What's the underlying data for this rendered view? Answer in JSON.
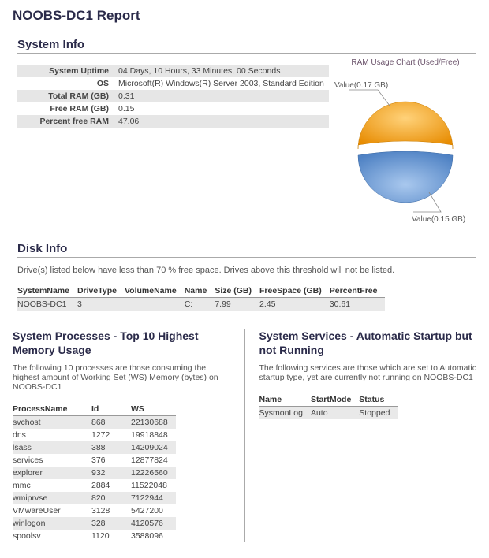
{
  "title": "NOOBS-DC1 Report",
  "system_info": {
    "heading": "System Info",
    "rows": [
      {
        "k": "System Uptime",
        "v": "04 Days, 10 Hours, 33 Minutes, 00 Seconds"
      },
      {
        "k": "OS",
        "v": "Microsoft(R) Windows(R) Server 2003, Standard Edition"
      },
      {
        "k": "Total RAM (GB)",
        "v": "0.31"
      },
      {
        "k": "Free RAM (GB)",
        "v": "0.15"
      },
      {
        "k": "Percent free RAM",
        "v": "47.06"
      }
    ]
  },
  "chart": {
    "title": "RAM Usage Chart (Used/Free)",
    "label_used": "Value(0.17 GB)",
    "label_free": "Value(0.15 GB)",
    "colors": {
      "used": "#f5a623",
      "used_dark": "#c97c00",
      "free": "#6aa0de",
      "free_dark": "#3d6aa3"
    }
  },
  "chart_data": {
    "type": "pie",
    "title": "RAM Usage Chart (Used/Free)",
    "categories": [
      "Used",
      "Free"
    ],
    "values": [
      0.17,
      0.15
    ],
    "unit": "GB"
  },
  "disk_info": {
    "heading": "Disk Info",
    "note": "Drive(s) listed below have less than 70 % free space. Drives above this threshold will not be listed.",
    "headers": [
      "SystemName",
      "DriveType",
      "VolumeName",
      "Name",
      "Size (GB)",
      "FreeSpace (GB)",
      "PercentFree"
    ],
    "rows": [
      {
        "SystemName": "NOOBS-DC1",
        "DriveType": "3",
        "VolumeName": "",
        "Name": "C:",
        "Size": "7.99",
        "FreeSpace": "2.45",
        "PercentFree": "30.61"
      }
    ]
  },
  "processes": {
    "heading": "System Processes - Top 10 Highest Memory Usage",
    "desc": "The following 10 processes are those consuming the highest amount of Working Set (WS) Memory (bytes) on NOOBS-DC1",
    "headers": [
      "ProcessName",
      "Id",
      "WS"
    ],
    "rows": [
      {
        "ProcessName": "svchost",
        "Id": "868",
        "WS": "22130688"
      },
      {
        "ProcessName": "dns",
        "Id": "1272",
        "WS": "19918848"
      },
      {
        "ProcessName": "lsass",
        "Id": "388",
        "WS": "14209024"
      },
      {
        "ProcessName": "services",
        "Id": "376",
        "WS": "12877824"
      },
      {
        "ProcessName": "explorer",
        "Id": "932",
        "WS": "12226560"
      },
      {
        "ProcessName": "mmc",
        "Id": "2884",
        "WS": "11522048"
      },
      {
        "ProcessName": "wmiprvse",
        "Id": "820",
        "WS": "7122944"
      },
      {
        "ProcessName": "VMwareUser",
        "Id": "3128",
        "WS": "5427200"
      },
      {
        "ProcessName": "winlogon",
        "Id": "328",
        "WS": "4120576"
      },
      {
        "ProcessName": "spoolsv",
        "Id": "1120",
        "WS": "3588096"
      }
    ]
  },
  "services": {
    "heading": "System Services - Automatic Startup but not Running",
    "desc": "The following services are those which are set to Automatic startup type, yet are currently not running on NOOBS-DC1",
    "headers": [
      "Name",
      "StartMode",
      "Status"
    ],
    "rows": [
      {
        "Name": "SysmonLog",
        "StartMode": "Auto",
        "Status": "Stopped"
      }
    ]
  }
}
